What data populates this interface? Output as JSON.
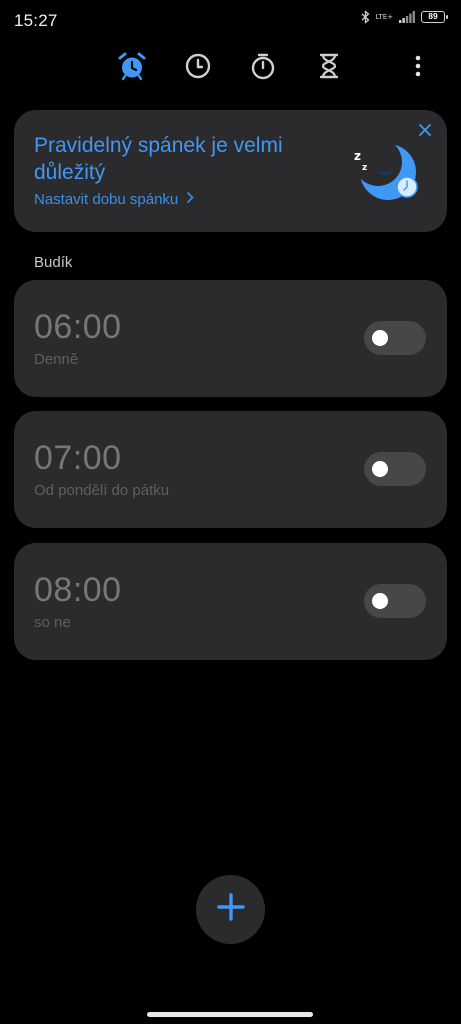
{
  "status_bar": {
    "time": "15:27",
    "network": "LTE+",
    "battery": "89"
  },
  "tabs": [
    {
      "name": "alarm",
      "icon": "alarm-clock-icon",
      "active": true
    },
    {
      "name": "clock",
      "icon": "clock-icon",
      "active": false
    },
    {
      "name": "stopwatch",
      "icon": "stopwatch-icon",
      "active": false
    },
    {
      "name": "timer",
      "icon": "hourglass-icon",
      "active": false
    }
  ],
  "promo": {
    "title": "Pravidelný spánek je velmi důležitý",
    "link_label": "Nastavit dobu spánku",
    "illustration": "sleeping-moon-icon"
  },
  "section_label": "Budík",
  "alarms": [
    {
      "time": "06:00",
      "repeat": "Denně",
      "enabled": false
    },
    {
      "time": "07:00",
      "repeat": "Od pondělí do pátku",
      "enabled": false
    },
    {
      "time": "08:00",
      "repeat": "so ne",
      "enabled": false
    }
  ],
  "colors": {
    "accent": "#3f97f6",
    "background": "#000000",
    "card": "#2b2b2d",
    "inactive_icon": "#cfcfcf"
  },
  "fab_icon": "plus-icon"
}
